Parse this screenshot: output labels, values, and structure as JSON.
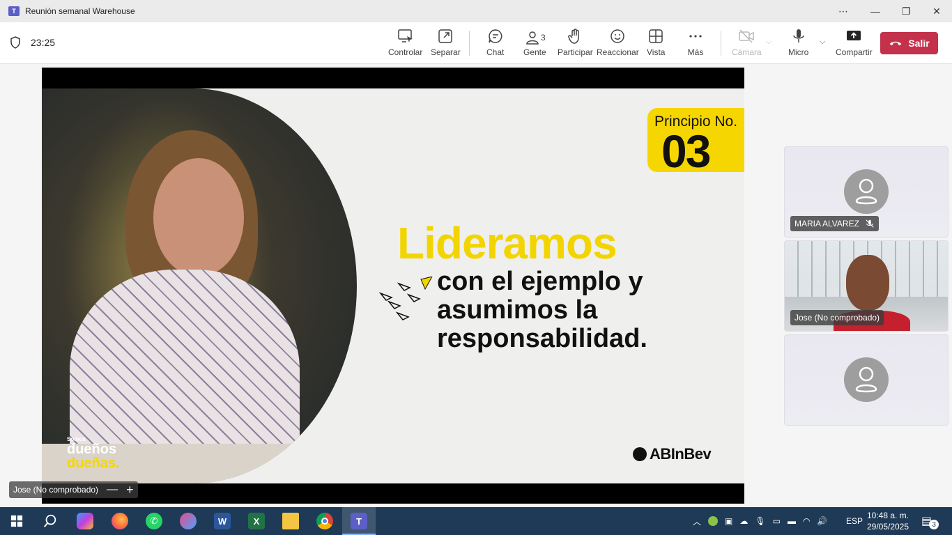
{
  "window": {
    "app_icon": "teams-logo-icon",
    "title": "Reunión semanal Warehouse",
    "controls": [
      "more-options-icon",
      "minimize-icon",
      "maximize-icon",
      "close-icon"
    ]
  },
  "toolbar": {
    "timer": "23:25",
    "buttons": [
      {
        "label": "Controlar",
        "icon": "control-icon"
      },
      {
        "label": "Separar",
        "icon": "popout-icon"
      },
      {
        "label": "Chat",
        "icon": "chat-icon"
      },
      {
        "label": "Gente",
        "icon": "people-icon",
        "count": "3"
      },
      {
        "label": "Participar",
        "icon": "raise-hand-icon"
      },
      {
        "label": "Reaccionar",
        "icon": "react-icon"
      },
      {
        "label": "Vista",
        "icon": "view-icon"
      },
      {
        "label": "Más",
        "icon": "more-icon"
      },
      {
        "label": "Cámara",
        "icon": "camera-off-icon",
        "disabled": true
      },
      {
        "label": "Micro",
        "icon": "mic-icon"
      },
      {
        "label": "Compartir",
        "icon": "share-icon"
      }
    ],
    "leave_label": "Salir",
    "leave_color": "#c4314b"
  },
  "slide": {
    "principio_label": "Principio No.",
    "principio_number": "03",
    "headline": "Lideramos",
    "body_lines": [
      "con el ejemplo y",
      "asumimos la",
      "responsabilidad."
    ],
    "brand_line1": "Somos",
    "brand_line2": "dueños",
    "brand_line3": "dueñas.",
    "logo": "ABInBev",
    "accent": "#f6d600"
  },
  "share_presenter": "Jose (No comprobado)",
  "participants": [
    {
      "name": "MARIA ALVAREZ",
      "muted": true,
      "video": false
    },
    {
      "name": "Jose (No comprobado)",
      "muted": false,
      "video": true
    },
    {
      "name": "",
      "muted": false,
      "video": false
    }
  ],
  "taskbar": {
    "apps": [
      {
        "name": "start",
        "icon": "windows-start-icon"
      },
      {
        "name": "search",
        "icon": "search-icon"
      },
      {
        "name": "copilot",
        "icon": "copilot-icon"
      },
      {
        "name": "firefox",
        "icon": "firefox-icon"
      },
      {
        "name": "whatsapp",
        "icon": "whatsapp-icon"
      },
      {
        "name": "snipping",
        "icon": "snipping-tool-icon"
      },
      {
        "name": "word",
        "icon": "word-icon",
        "label": "W"
      },
      {
        "name": "excel",
        "icon": "excel-icon",
        "label": "X"
      },
      {
        "name": "explorer",
        "icon": "folder-icon"
      },
      {
        "name": "chrome",
        "icon": "chrome-icon"
      },
      {
        "name": "teams",
        "icon": "teams-icon",
        "label": "T",
        "active": true
      }
    ],
    "lang": "ESP",
    "time": "10:48 a. m.",
    "date": "29/05/2025",
    "notifications": "3"
  }
}
